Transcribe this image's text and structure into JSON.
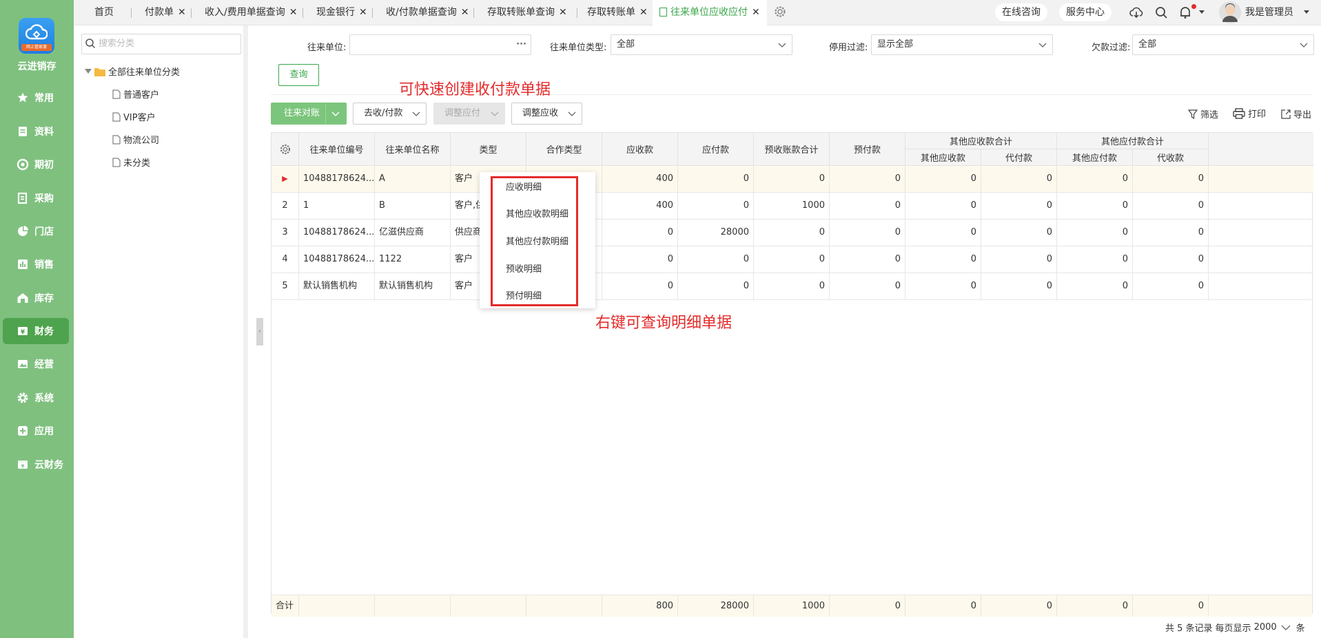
{
  "app": {
    "name": "云进销存",
    "logo_tag": "网上管家婆"
  },
  "sidebar": {
    "items": [
      {
        "label": "常用",
        "icon": "star-icon"
      },
      {
        "label": "资料",
        "icon": "document-icon"
      },
      {
        "label": "期初",
        "icon": "target-icon"
      },
      {
        "label": "采购",
        "icon": "purchase-icon"
      },
      {
        "label": "门店",
        "icon": "pie-icon"
      },
      {
        "label": "销售",
        "icon": "sales-chart-icon"
      },
      {
        "label": "库存",
        "icon": "warehouse-icon"
      },
      {
        "label": "财务",
        "icon": "finance-icon",
        "active": true
      },
      {
        "label": "经营",
        "icon": "image-icon"
      },
      {
        "label": "系统",
        "icon": "gear-icon"
      },
      {
        "label": "应用",
        "icon": "plus-box-icon"
      },
      {
        "label": "云财务",
        "icon": "cloud-finance-icon"
      }
    ]
  },
  "tabs": [
    {
      "label": "首页",
      "closable": false
    },
    {
      "label": "付款单",
      "closable": true
    },
    {
      "label": "收入/费用单据查询",
      "closable": true
    },
    {
      "label": "现金银行",
      "closable": true
    },
    {
      "label": "收/付款单据查询",
      "closable": true
    },
    {
      "label": "存取转账单查询",
      "closable": true
    },
    {
      "label": "存取转账单",
      "closable": true
    },
    {
      "label": "往来单位应收应付",
      "closable": true,
      "active": true
    }
  ],
  "topbar": {
    "consult": "在线咨询",
    "service": "服务中心",
    "user": "我是管理员"
  },
  "tree": {
    "search_placeholder": "搜索分类",
    "root": "全部往来单位分类",
    "children": [
      "普通客户",
      "VIP客户",
      "物流公司",
      "未分类"
    ]
  },
  "filters": {
    "unit_label": "往来单位:",
    "unit_value": "",
    "type_label": "往来单位类型:",
    "type_value": "全部",
    "disable_label": "停用过滤:",
    "disable_value": "显示全部",
    "debt_label": "欠款过滤:",
    "debt_value": "全部",
    "query_btn": "查询"
  },
  "toolbar": {
    "reconcile": "往来对账",
    "collect_pay": "去收/付款",
    "adjust_payable": "调整应付",
    "adjust_receivable": "调整应收",
    "filter": "筛选",
    "print": "打印",
    "export": "导出"
  },
  "annotations": {
    "top": "可快速创建收付款单据",
    "right": "右键可查询明细单据"
  },
  "grid": {
    "headers": {
      "code": "往来单位编号",
      "name": "往来单位名称",
      "type": "类型",
      "coop": "合作类型",
      "receivable": "应收款",
      "payable": "应付款",
      "prereceipt_total": "预收账款合计",
      "prepaid": "预付款",
      "other_recv_group": "其他应收款合计",
      "other_recv": "其他应收款",
      "on_behalf_pay": "代付款",
      "other_pay_group": "其他应付款合计",
      "other_pay": "其他应付款",
      "on_behalf_recv": "代收款"
    },
    "rows": [
      {
        "no": "",
        "code": "10488178624...",
        "name": "A",
        "type": "客户",
        "coop": "",
        "receivable": "400",
        "payable": "0",
        "prereceipt": "0",
        "prepaid": "0",
        "other_recv": "0",
        "on_behalf_pay": "0",
        "other_pay": "0",
        "on_behalf_recv": "0"
      },
      {
        "no": "2",
        "code": "1",
        "name": "B",
        "type": "客户,供",
        "coop": "",
        "receivable": "400",
        "payable": "0",
        "prereceipt": "1000",
        "prepaid": "0",
        "other_recv": "0",
        "on_behalf_pay": "0",
        "other_pay": "0",
        "on_behalf_recv": "0"
      },
      {
        "no": "3",
        "code": "10488178624...",
        "name": "亿滋供应商",
        "type": "供应商",
        "coop": "",
        "receivable": "0",
        "payable": "28000",
        "prereceipt": "0",
        "prepaid": "0",
        "other_recv": "0",
        "on_behalf_pay": "0",
        "other_pay": "0",
        "on_behalf_recv": "0"
      },
      {
        "no": "4",
        "code": "10488178624...",
        "name": "1122",
        "type": "客户",
        "coop": "",
        "receivable": "0",
        "payable": "0",
        "prereceipt": "0",
        "prepaid": "0",
        "other_recv": "0",
        "on_behalf_pay": "0",
        "other_pay": "0",
        "on_behalf_recv": "0"
      },
      {
        "no": "5",
        "code": "默认销售机构",
        "name": "默认销售机构",
        "type": "客户",
        "coop": "",
        "receivable": "0",
        "payable": "0",
        "prereceipt": "0",
        "prepaid": "0",
        "other_recv": "0",
        "on_behalf_pay": "0",
        "other_pay": "0",
        "on_behalf_recv": "0"
      }
    ],
    "footer": {
      "label": "合计",
      "receivable": "800",
      "payable": "28000",
      "prereceipt": "1000",
      "prepaid": "0",
      "other_recv": "0",
      "on_behalf_pay": "0",
      "other_pay": "0",
      "on_behalf_recv": "0"
    }
  },
  "context_menu": [
    "应收明细",
    "其他应收款明细",
    "其他应付款明细",
    "预收明细",
    "预付明细"
  ],
  "pagination": {
    "summary": "共 5 条记录",
    "per_page_label": "每页显示",
    "per_page_value": "2000",
    "unit": "条"
  },
  "colors": {
    "sidebar_bg": "#7fc07f",
    "active_tab_text": "#3aa64a",
    "annotation_red": "#e32b2b",
    "selected_row_bg": "#fdf9ec"
  }
}
